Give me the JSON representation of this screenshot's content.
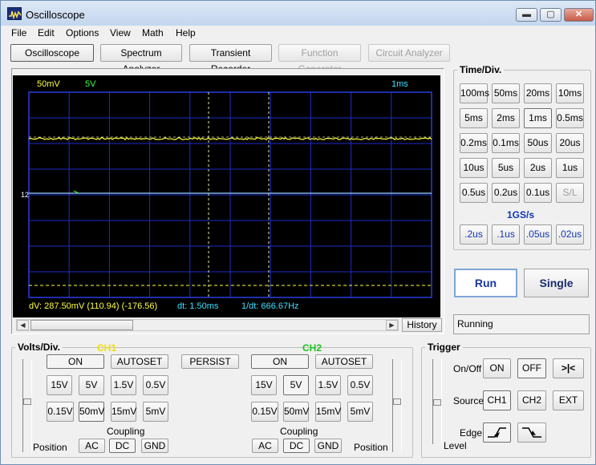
{
  "window": {
    "title": "Oscilloscope",
    "min_label": "▬",
    "max_label": "▢",
    "close_label": "✕"
  },
  "menu": [
    "File",
    "Edit",
    "Options",
    "View",
    "Math",
    "Help"
  ],
  "toolbar": {
    "oscilloscope": "Oscilloscope",
    "spectrum": "Spectrum Analyzer",
    "transient": "Transient Recorder",
    "function_gen": "Function Generator",
    "circuit": "Circuit Analyzer"
  },
  "screen": {
    "ch1_scale": "50mV",
    "ch2_scale": "5V",
    "time_scale": "1ms",
    "ch_marker": "12",
    "dv": "dV: 287.50mV (110.94) (-176.56)",
    "dt": "dt: 1.50ms",
    "inv_dt": "1/dt: 666.67Hz",
    "colors": {
      "ch1": "#ffff3c",
      "ch2": "#3cff3c",
      "time": "#3ce0ff",
      "grid": "#1d2dc8",
      "cursor": "#e8e8a0"
    }
  },
  "history_label": "History",
  "time_div": {
    "title": "Time/Div.",
    "rows": [
      [
        "100ms",
        "50ms",
        "20ms",
        "10ms"
      ],
      [
        "5ms",
        "2ms",
        "1ms",
        "0.5ms"
      ],
      [
        "0.2ms",
        "0.1ms",
        "50us",
        "20us"
      ],
      [
        "10us",
        "5us",
        "2us",
        "1us"
      ],
      [
        "0.5us",
        "0.2us",
        "0.1us",
        "S/L"
      ]
    ],
    "rate_label": "1GS/s",
    "fast": [
      ".2us",
      ".1us",
      ".05us",
      ".02us"
    ]
  },
  "run_label": "Run",
  "single_label": "Single",
  "status_text": "Running",
  "volts": {
    "title": "Volts/Div.",
    "ch1_label": "CH1",
    "ch2_label": "CH2",
    "on": "ON",
    "autoset": "AUTOSET",
    "persist": "PERSIST",
    "row1": [
      "15V",
      "5V",
      "1.5V",
      "0.5V"
    ],
    "row2": [
      "0.15V",
      "50mV",
      "15mV",
      "5mV"
    ],
    "coupling": "Coupling",
    "ac": "AC",
    "dc": "DC",
    "gnd": "GND",
    "position": "Position"
  },
  "trigger": {
    "title": "Trigger",
    "onoff": "On/Off",
    "on": "ON",
    "off": "OFF",
    "cursor_btn": ">|<",
    "source": "Source",
    "ch1": "CH1",
    "ch2": "CH2",
    "ext": "EXT",
    "edge": "Edge",
    "level": "Level"
  }
}
